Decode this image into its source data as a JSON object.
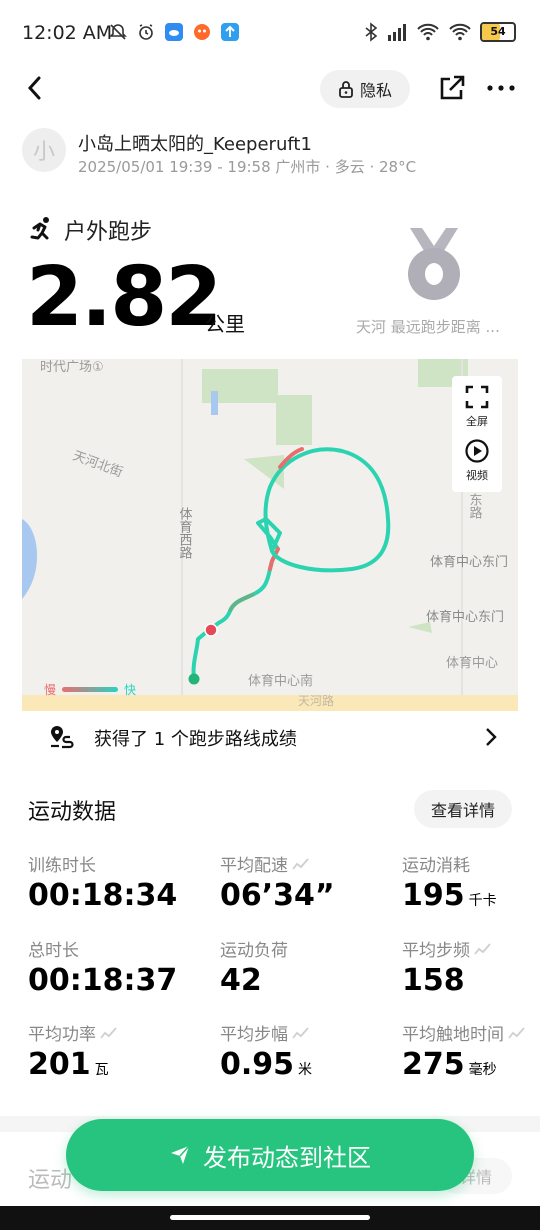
{
  "status_bar": {
    "time": "12:02 AM",
    "battery": "54"
  },
  "header": {
    "privacy_label": "隐私"
  },
  "user": {
    "avatar_char": "小",
    "name": "小岛上晒太阳的_Keeperuft1",
    "meta": "2025/05/01 19:39 - 19:58 广州市 · 多云 · 28°C"
  },
  "activity": {
    "type": "户外跑步",
    "distance": "2.82",
    "distance_unit": "公里",
    "medal_text": "天河 最远跑步距离 ..."
  },
  "map": {
    "labels": [
      "时代广场①",
      "天河北街",
      "体育西路",
      "体育中心东门",
      "体育中心东门",
      "体育中心",
      "体育中心南",
      "天河路",
      "东路"
    ],
    "fullscreen_label": "全屏",
    "video_label": "视频",
    "legend_slow": "慢",
    "legend_fast": "快",
    "slow_color": "#e86e6e",
    "fast_color": "#29d3c2"
  },
  "achievement": {
    "text": "获得了 1 个跑步路线成绩"
  },
  "stats": {
    "title": "运动数据",
    "detail_label": "查看详情",
    "items": [
      {
        "label": "训练时长",
        "value": "00:18:34",
        "unit": ""
      },
      {
        "label": "平均配速",
        "value": "06’34”",
        "unit": ""
      },
      {
        "label": "运动消耗",
        "value": "195",
        "unit": "千卡"
      },
      {
        "label": "总时长",
        "value": "00:18:37",
        "unit": ""
      },
      {
        "label": "运动负荷",
        "value": "42",
        "unit": ""
      },
      {
        "label": "平均步频",
        "value": "158",
        "unit": ""
      },
      {
        "label": "平均功率",
        "value": "201",
        "unit": "瓦"
      },
      {
        "label": "平均步幅",
        "value": "0.95",
        "unit": "米"
      },
      {
        "label": "平均触地时间",
        "value": "275",
        "unit": "毫秒"
      }
    ]
  },
  "section2": {
    "title": "运动",
    "detail_label": "详情"
  },
  "publish": {
    "label": "发布动态到社区"
  },
  "colors": {
    "accent": "#27c47f",
    "track": "#2cd3b0"
  }
}
